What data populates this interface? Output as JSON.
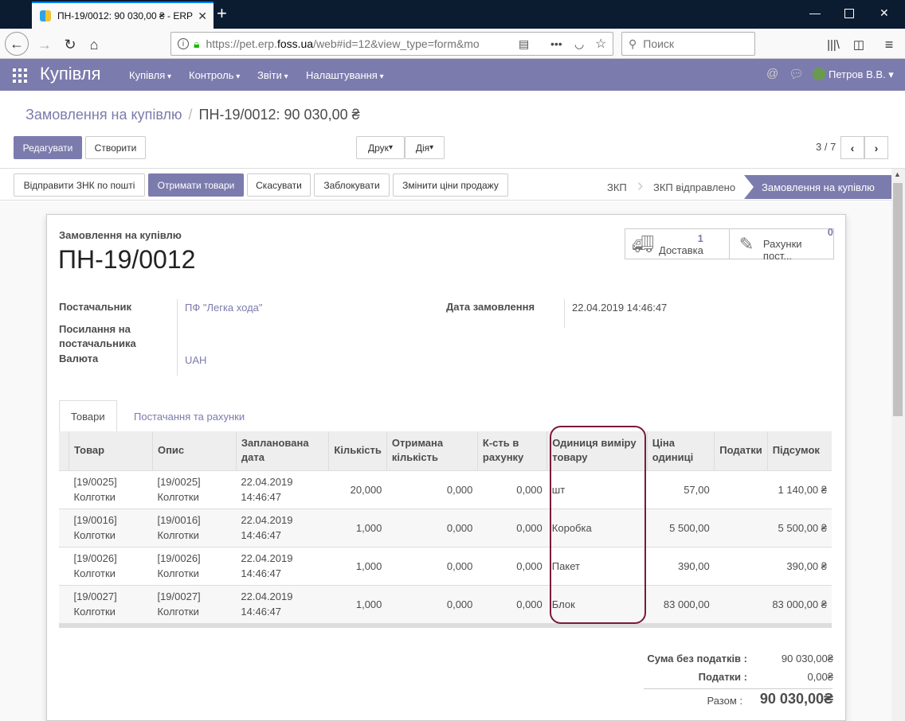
{
  "browser": {
    "tab_title": "ПН-19/0012: 90 030,00 ₴ - ERP",
    "url_prefix": "https://pet.erp.",
    "url_domain": "foss.ua",
    "url_suffix": "/web#id=12&view_type=form&mo",
    "search_placeholder": "Поиск"
  },
  "app": {
    "brand": "Купівля",
    "menus": [
      "Купівля",
      "Контроль",
      "Звіти",
      "Налаштування"
    ],
    "user": "Петров В.В."
  },
  "breadcrumb": {
    "parent": "Замовлення на купівлю",
    "current": "ПН-19/0012: 90 030,00 ₴"
  },
  "buttons": {
    "edit": "Редагувати",
    "create": "Створити",
    "print": "Друк",
    "action": "Дія",
    "pager": "3 / 7",
    "send_rfq": "Відправити ЗНК по пошті",
    "receive": "Отримати товари",
    "cancel": "Скасувати",
    "lock": "Заблокувати",
    "change_prices": "Змінити ціни продажу"
  },
  "stages": [
    "ЗКП",
    "ЗКП відправлено",
    "Замовлення на купівлю"
  ],
  "form": {
    "doc_type": "Замовлення на купівлю",
    "name": "ПН-19/0012",
    "smart_buttons": [
      {
        "count": "1",
        "label": "Доставка",
        "icon": "truck-icon"
      },
      {
        "count": "0",
        "label": "Рахунки пост...",
        "icon": "edit-icon"
      }
    ],
    "labels": {
      "vendor": "Постачальник",
      "vendor_ref": "Посилання на постачальника",
      "currency": "Валюта",
      "order_date": "Дата замовлення"
    },
    "values": {
      "vendor": "ПФ \"Легка хода\"",
      "currency": "UAH",
      "order_date": "22.04.2019 14:46:47"
    }
  },
  "notebook": {
    "tabs": [
      "Товари",
      "Постачання та рахунки"
    ]
  },
  "lines": {
    "headers": [
      "Товар",
      "Опис",
      "Запланована дата",
      "Кількість",
      "Отримана кількість",
      "К-сть в рахунку",
      "Одиниця виміру товару",
      "Ціна одиниці",
      "Податки",
      "Підсумок"
    ],
    "rows": [
      {
        "product": "[19/0025] Колготки",
        "desc": "[19/0025] Колготки",
        "date": "22.04.2019 14:46:47",
        "qty": "20,000",
        "received": "0,000",
        "billed": "0,000",
        "uom": "шт",
        "price": "57,00",
        "taxes": "",
        "subtotal": "1 140,00 ₴"
      },
      {
        "product": "[19/0016] Колготки",
        "desc": "[19/0016] Колготки",
        "date": "22.04.2019 14:46:47",
        "qty": "1,000",
        "received": "0,000",
        "billed": "0,000",
        "uom": "Коробка",
        "price": "5 500,00",
        "taxes": "",
        "subtotal": "5 500,00 ₴"
      },
      {
        "product": "[19/0026] Колготки",
        "desc": "[19/0026] Колготки",
        "date": "22.04.2019 14:46:47",
        "qty": "1,000",
        "received": "0,000",
        "billed": "0,000",
        "uom": "Пакет",
        "price": "390,00",
        "taxes": "",
        "subtotal": "390,00 ₴"
      },
      {
        "product": "[19/0027] Колготки",
        "desc": "[19/0027] Колготки",
        "date": "22.04.2019 14:46:47",
        "qty": "1,000",
        "received": "0,000",
        "billed": "0,000",
        "uom": "Блок",
        "price": "83 000,00",
        "taxes": "",
        "subtotal": "83 000,00 ₴"
      }
    ]
  },
  "totals": {
    "untaxed_label": "Сума без податків :",
    "untaxed": "90 030,00₴",
    "taxes_label": "Податки :",
    "taxes": "0,00₴",
    "total_label": "Разом :",
    "total": "90 030,00₴"
  },
  "colors": {
    "brand": "#7c7bad",
    "highlight": "#7a1a3a"
  }
}
